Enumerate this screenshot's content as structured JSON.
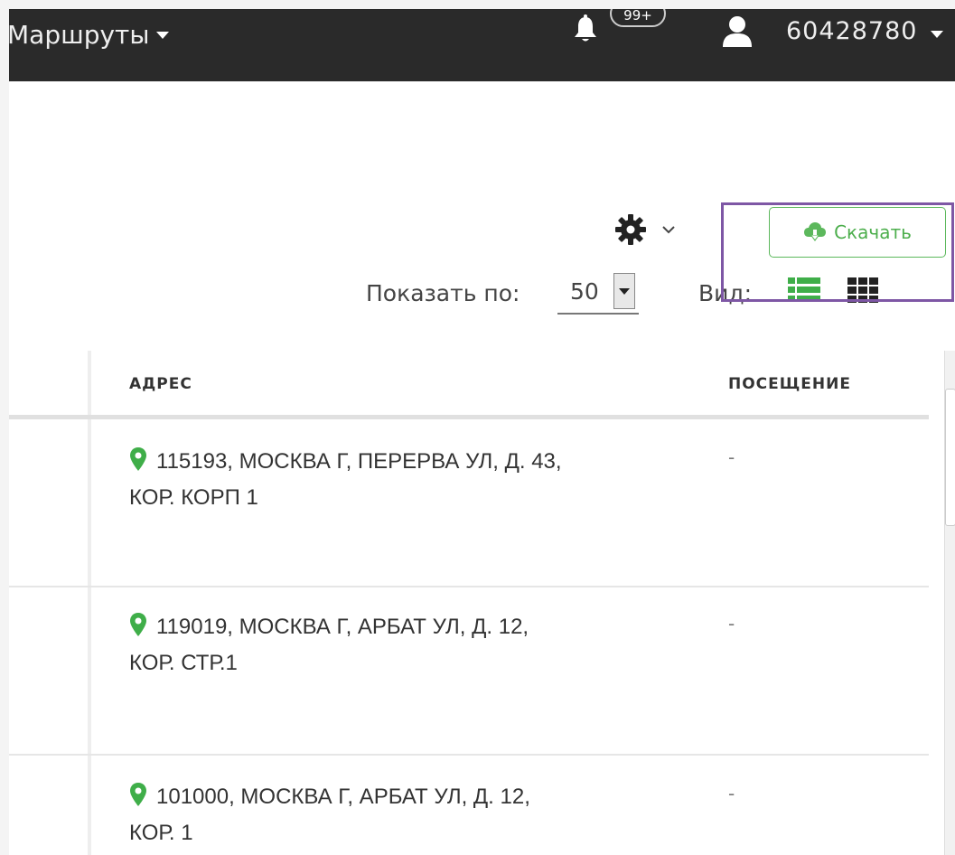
{
  "topbar": {
    "routes_label": "Маршруты",
    "notifications_badge": "99+",
    "user_id": "60428780"
  },
  "toolbar": {
    "download_label": "Скачать",
    "show_per_page_label": "Показать по:",
    "per_page_value": "50",
    "view_label": "Вид:"
  },
  "table": {
    "headers": {
      "address": "АДРЕС",
      "visit": "ПОСЕЩЕНИЕ"
    },
    "rows": [
      {
        "address_line1": "115193, МОСКВА Г, ПЕРЕРВА УЛ, Д. 43,",
        "address_line2": "КОР. КОРП 1",
        "visit": "-"
      },
      {
        "address_line1": "119019, МОСКВА Г, АРБАТ УЛ, Д. 12,",
        "address_line2": "КОР. СТР.1",
        "visit": "-"
      },
      {
        "address_line1": "101000, МОСКВА Г, АРБАТ УЛ, Д. 12,",
        "address_line2": "КОР. 1",
        "visit": "-"
      }
    ]
  },
  "colors": {
    "topbar_bg": "#2a2a2a",
    "accent_green": "#5cb85c",
    "highlight_purple": "#7e57a5"
  },
  "icons": [
    "bell-icon",
    "user-icon",
    "gear-icon",
    "chevron-down-icon",
    "cloud-download-icon",
    "list-view-icon",
    "grid-view-icon",
    "map-pin-icon"
  ]
}
